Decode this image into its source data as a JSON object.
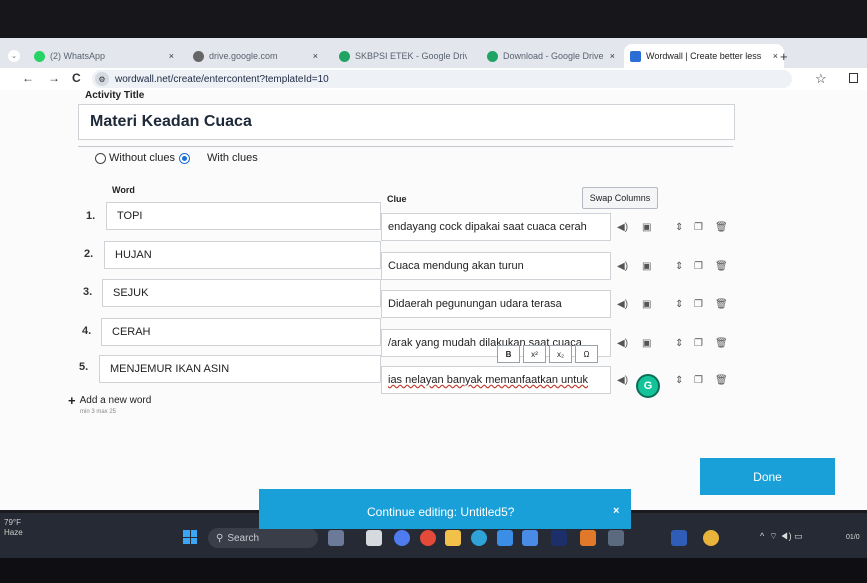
{
  "browser": {
    "tabs": [
      {
        "label": "(2) WhatsApp",
        "icon": "whatsapp-icon",
        "color": "#25d366"
      },
      {
        "label": "drive.google.com",
        "icon": "globe-icon",
        "color": "#555555"
      },
      {
        "label": "SKBPSI ETEK - Google Drive",
        "icon": "google-drive-icon",
        "color": "#1fa463"
      },
      {
        "label": "Download - Google Drive",
        "icon": "google-drive-icon",
        "color": "#1fa463"
      },
      {
        "label": "Wordwall | Create better less",
        "icon": "wordwall-icon",
        "color": "#2b6fd6"
      }
    ],
    "close_glyph": "×",
    "new_tab": "+",
    "url": "wordwall.net/create/entercontent?templateId=10",
    "back": "←",
    "forward": "→",
    "reload": "C",
    "bookmark": "☆"
  },
  "editor": {
    "activity_title_label": "Activity Title",
    "activity_title": "Materi Keadan Cuaca",
    "options": {
      "without": "Without clues",
      "with": "With clues",
      "selected": "with"
    },
    "column_word": "Word",
    "column_clue": "Clue",
    "swap_label": "Swap Columns",
    "rows": [
      {
        "num": "1.",
        "word": "TOPI",
        "clue": "endayang cock dipakai saat cuaca cerah"
      },
      {
        "num": "2.",
        "word": "HUJAN",
        "clue": "Cuaca mendung akan turun"
      },
      {
        "num": "3.",
        "word": "SEJUK",
        "clue": "Didaerah pegunungan udara terasa"
      },
      {
        "num": "4.",
        "word": "CERAH",
        "clue": "/arak yang mudah dilakukan saat cuaca"
      },
      {
        "num": "5.",
        "word": "MENJEMUR IKAN ASIN",
        "clue": "ias nelayan banyak memanfaatkan untuk"
      }
    ],
    "format_buttons": [
      "B",
      "x²",
      "x₂",
      "Ω"
    ],
    "grammarly": "G",
    "add_word": "Add a new word",
    "minmax": "min 3   max 25",
    "done": "Done"
  },
  "banner": {
    "text": "Continue editing: Untitled5?",
    "close": "×"
  },
  "taskbar": {
    "weather_temp": "79°F",
    "weather_desc": "Haze",
    "search": "Search",
    "clock": "01/0"
  }
}
